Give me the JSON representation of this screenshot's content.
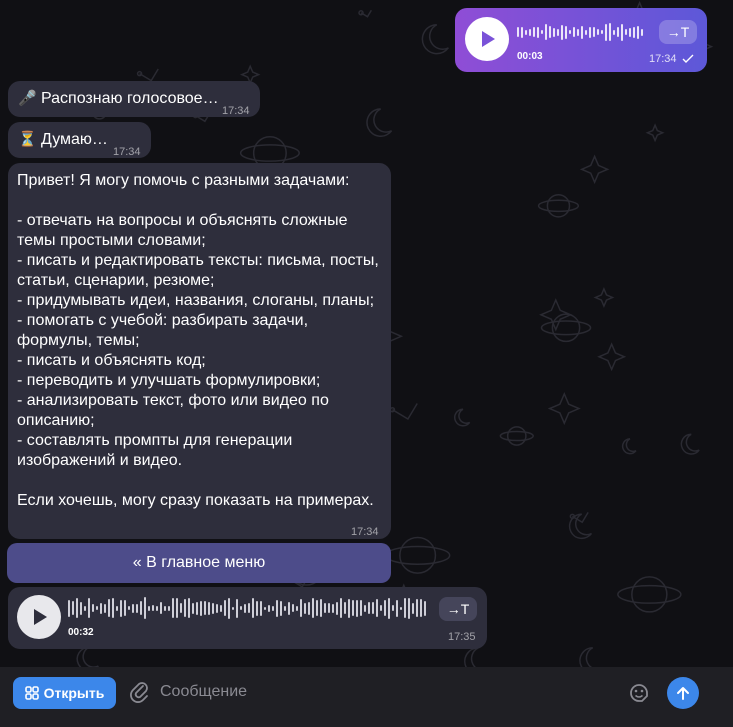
{
  "colors": {
    "background": "#101014",
    "incoming_bubble": "#2e2e3c",
    "outgoing_gradient_start": "#8f4dd6",
    "outgoing_gradient_end": "#5d58d8",
    "menu_button": "#4d4c8a",
    "accent": "#3c87ea",
    "composer": "#1f1f24"
  },
  "messages": {
    "voice_out": {
      "duration": "00:03",
      "time": "17:34",
      "transcribe_label": "→T"
    },
    "status1": {
      "icon": "🎤",
      "text": "Распознаю голосовое…",
      "time": "17:34"
    },
    "status2": {
      "icon": "⏳",
      "text": "Думаю…",
      "time": "17:34"
    },
    "reply": {
      "text": "Привет! Я могу помочь с разными задачами:\n\n- отвечать на вопросы и объяснять сложные темы простыми словами;\n- писать и редактировать тексты: письма, посты, статьи, сценарии, резюме;\n- придумывать идеи, названия, слоганы, планы;\n- помогать с учебой: разбирать задачи, формулы, темы;\n- писать и объяснять код;\n- переводить и улучшать формулировки;\n- анализировать текст, фото или видео по описанию;\n- составлять промпты для генерации изображений и видео.\n\nЕсли хочешь, могу сразу показать на примерах.",
      "time": "17:34"
    },
    "menu_button_label": "« В главное меню",
    "voice_in": {
      "duration": "00:32",
      "time": "17:35",
      "transcribe_label": "→T"
    }
  },
  "composer": {
    "open_label": "Открыть",
    "placeholder": "Сообщение"
  }
}
